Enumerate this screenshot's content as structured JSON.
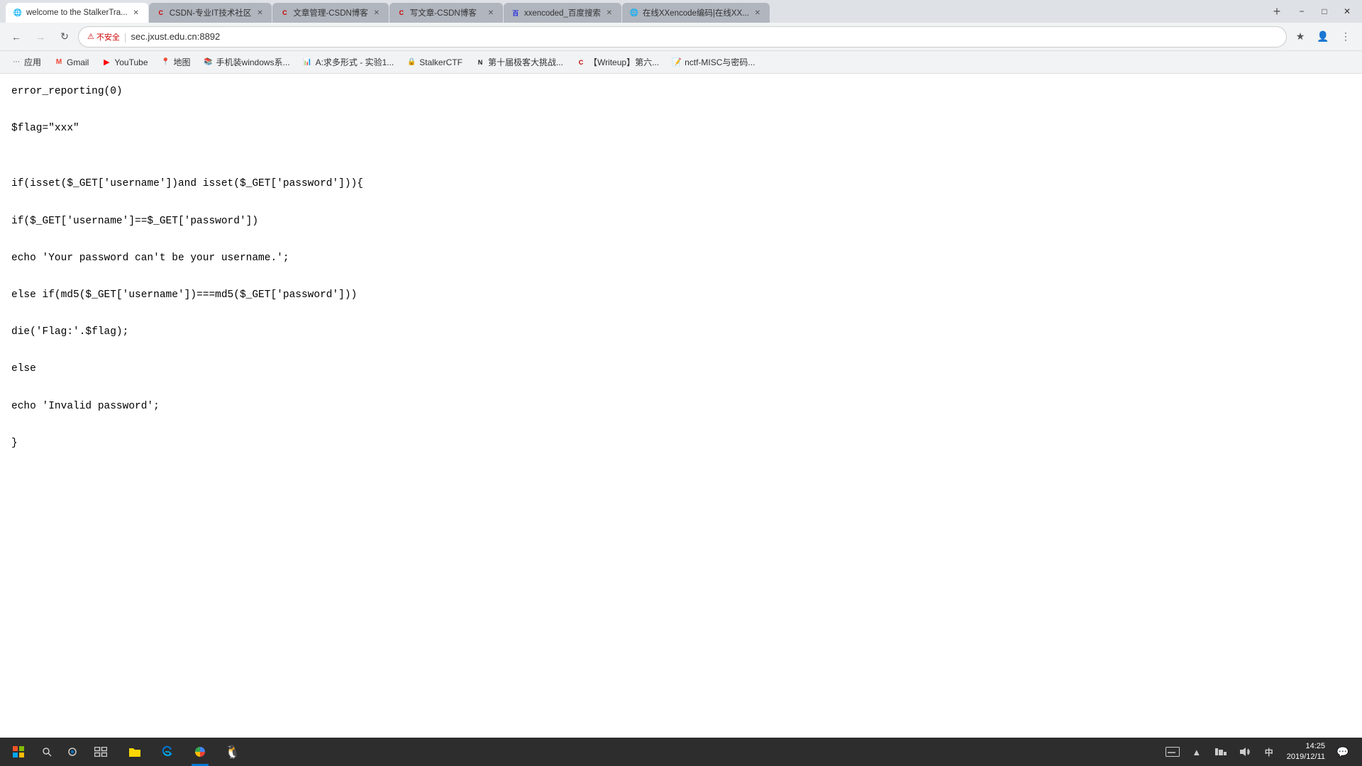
{
  "tabs": [
    {
      "id": "tab1",
      "label": "welcome to the StalkerTra...",
      "favicon": "🌐",
      "active": true,
      "closable": true
    },
    {
      "id": "tab2",
      "label": "CSDN-专业IT技术社区",
      "favicon": "C",
      "active": false,
      "closable": true
    },
    {
      "id": "tab3",
      "label": "文章管理-CSDN博客",
      "favicon": "C",
      "active": false,
      "closable": true
    },
    {
      "id": "tab4",
      "label": "写文章-CSDN博客",
      "favicon": "C",
      "active": false,
      "closable": true
    },
    {
      "id": "tab5",
      "label": "xxencoded_百度搜索",
      "favicon": "百",
      "active": false,
      "closable": true
    },
    {
      "id": "tab6",
      "label": "在线XXencode编码|在线XX...",
      "favicon": "🌐",
      "active": false,
      "closable": true
    }
  ],
  "navbar": {
    "back_title": "后退",
    "forward_title": "前进",
    "refresh_title": "刷新",
    "security_label": "不安全",
    "address": "sec.jxust.edu.cn:8892",
    "bookmark_title": "将此标签页加入书签",
    "menu_title": "自定义及控制 Google Chrome"
  },
  "bookmarks": [
    {
      "id": "bm1",
      "label": "应用",
      "favicon": "apps"
    },
    {
      "id": "bm2",
      "label": "Gmail",
      "favicon": "gmail"
    },
    {
      "id": "bm3",
      "label": "YouTube",
      "favicon": "youtube"
    },
    {
      "id": "bm4",
      "label": "地图",
      "favicon": "maps"
    },
    {
      "id": "bm5",
      "label": "手机装windows系...",
      "favicon": "book"
    },
    {
      "id": "bm6",
      "label": "A:求多形式 - 实验1...",
      "favicon": "chart"
    },
    {
      "id": "bm7",
      "label": "StalkerCTF",
      "favicon": "globe"
    },
    {
      "id": "bm8",
      "label": "第十届极客大挑战...",
      "favicon": "n"
    },
    {
      "id": "bm9",
      "label": "【Writeup】第六...",
      "favicon": "csdn"
    },
    {
      "id": "bm10",
      "label": "nctf-MISC与密码...",
      "favicon": "notion"
    }
  ],
  "code_lines": [
    "error_reporting(0)",
    "",
    "$flag=\"xxx\"",
    "",
    "",
    "if(isset($_GET['username'])and isset($_GET['password'])){",
    "",
    "if($_GET['username']==$_GET['password'])",
    "",
    "echo 'Your password can't be your username.';",
    "",
    "else if(md5($_GET['username'])===md5($_GET['password']))",
    "",
    "die('Flag:'.$flag);",
    "",
    "else",
    "",
    "echo 'Invalid password';",
    "",
    "}"
  ],
  "taskbar": {
    "time": "14:25",
    "date": "2019/12/11",
    "start_label": "开始",
    "search_label": "搜索",
    "cortana_label": "Cortana",
    "taskview_label": "任务视图"
  }
}
